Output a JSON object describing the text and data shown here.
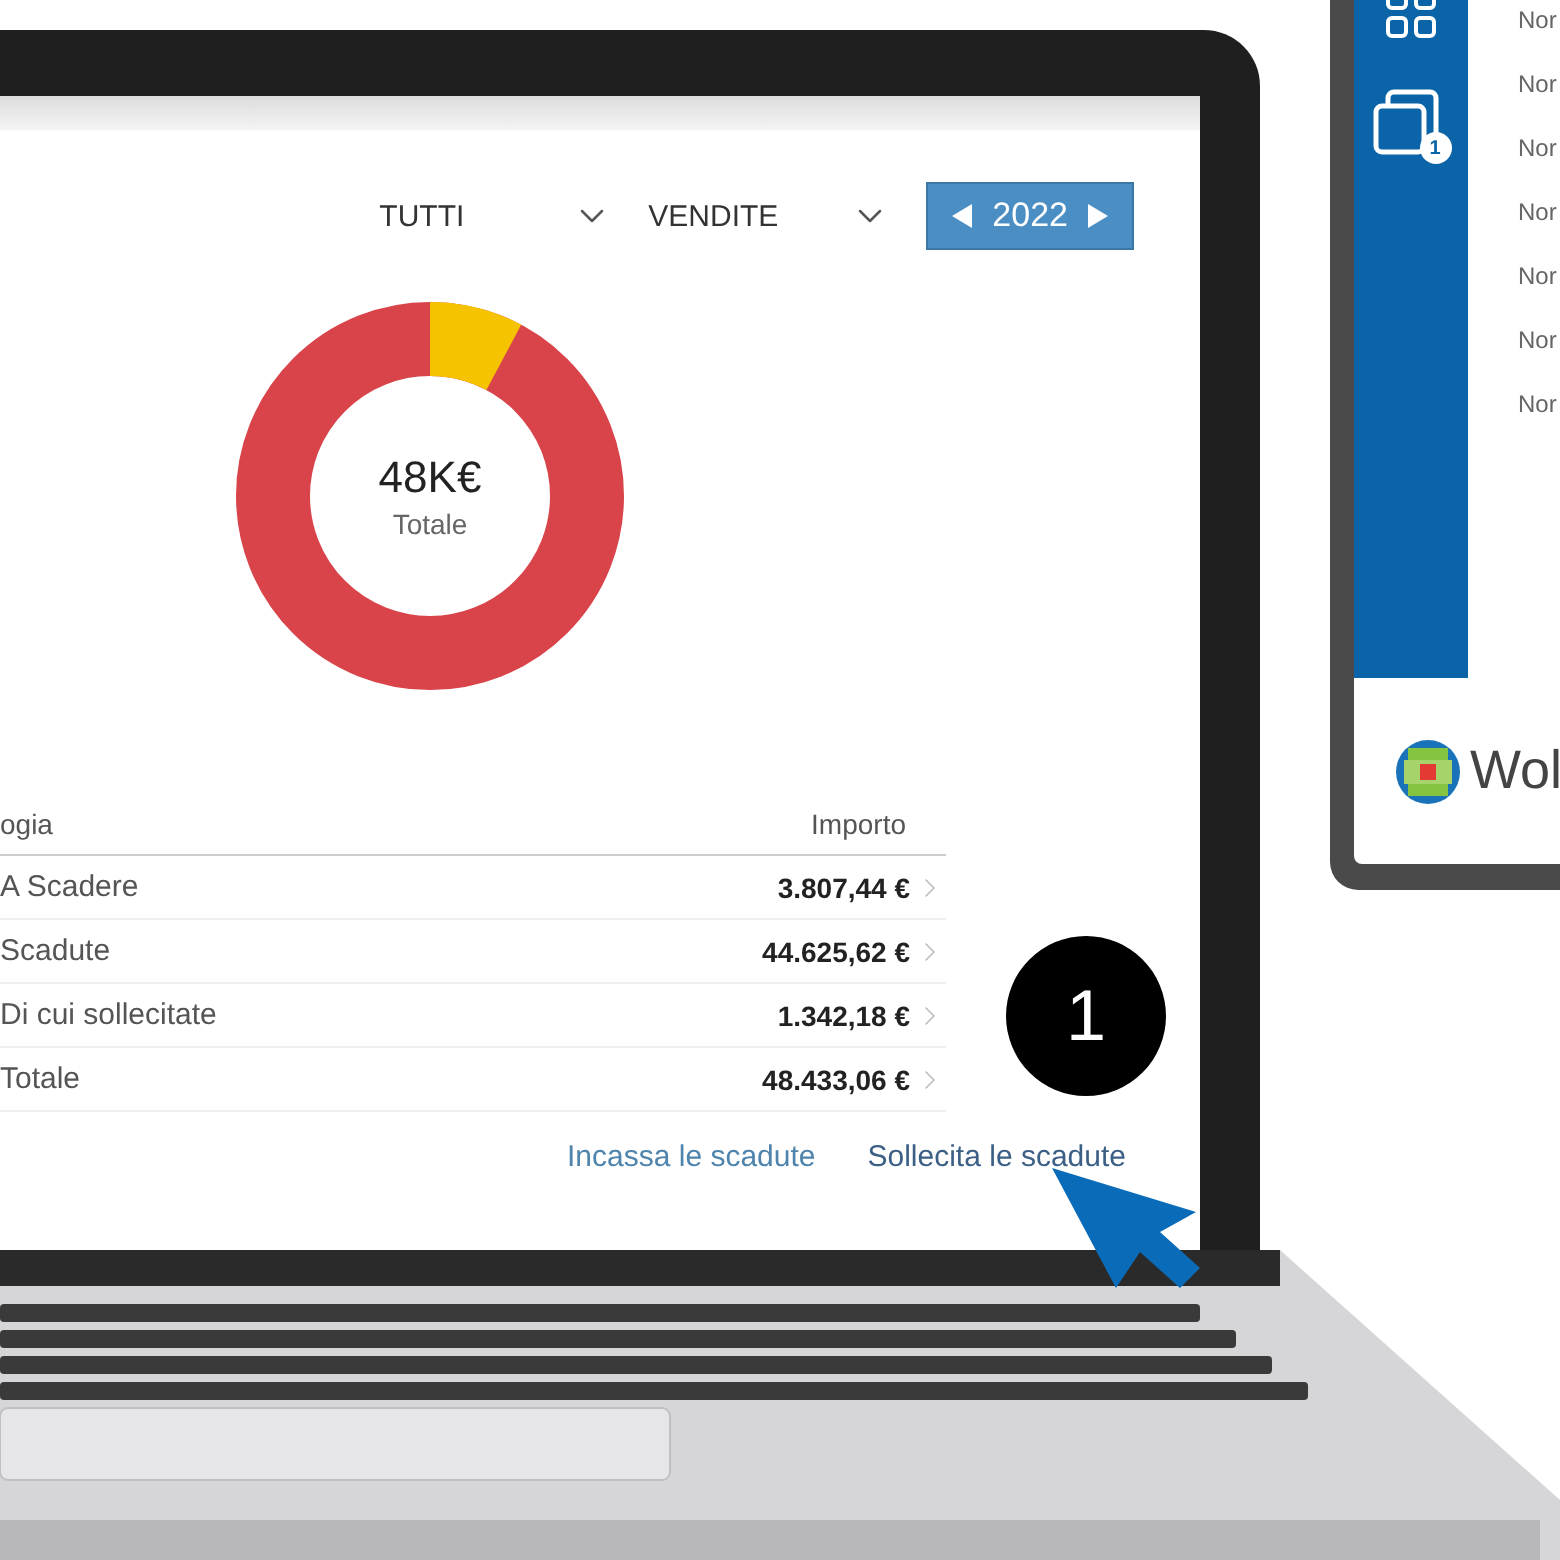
{
  "filters": [
    {
      "label": "TUTTI"
    },
    {
      "label": "VENDITE"
    }
  ],
  "year_picker": {
    "year": "2022"
  },
  "donut": {
    "value": "48K€",
    "label": "Totale"
  },
  "table": {
    "columns": [
      "ogia",
      "Importo"
    ],
    "rows": [
      {
        "label": "A Scadere",
        "amount": "3.807,44 €"
      },
      {
        "label": "Scadute",
        "amount": "44.625,62 €"
      },
      {
        "label": "Di cui sollecitate",
        "amount": "1.342,18 €"
      },
      {
        "label": "Totale",
        "amount": "48.433,06 €"
      }
    ]
  },
  "actions": [
    "Incassa le scadute",
    "Sollecita le scadute"
  ],
  "step_badge": "1",
  "tablet": {
    "notification_count": "1",
    "items": [
      "Nor",
      "Nor",
      "Nor",
      "Nor",
      "Nor",
      "Nor",
      "Nor"
    ],
    "brand": "Wol"
  }
}
